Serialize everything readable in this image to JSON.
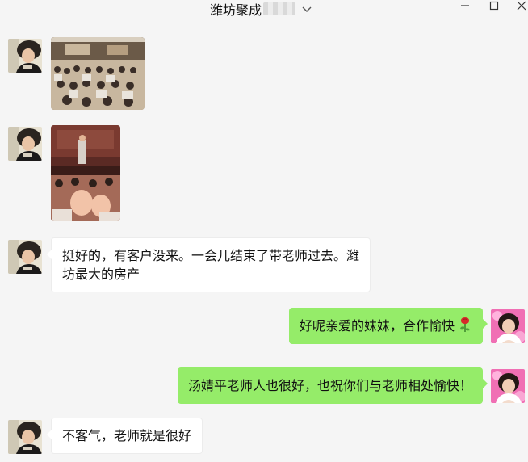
{
  "window": {
    "title": "潍坊聚成",
    "controls": [
      "minimize-icon",
      "maximize-icon",
      "close-icon"
    ]
  },
  "messages": [
    {
      "side": "in",
      "type": "image",
      "desc": "conference-hall-photo"
    },
    {
      "side": "in",
      "type": "image",
      "desc": "speaker-on-stage-photo"
    },
    {
      "side": "in",
      "type": "text",
      "lines": [
        "挺好的，有客户没来。一会儿结束了带老师过去。潍",
        "坊最大的房产"
      ]
    },
    {
      "side": "out",
      "type": "text",
      "text": "好呢亲爱的妹妹，合作愉快",
      "emoji": "rose-icon"
    },
    {
      "side": "out",
      "type": "text",
      "text": "汤婧平老师人也很好，也祝你们与老师相处愉快！"
    },
    {
      "side": "in",
      "type": "text",
      "text": "不客气，老师就是很好"
    }
  ],
  "colors": {
    "background": "#f5f5f5",
    "incoming_bubble": "#ffffff",
    "outgoing_bubble": "#95ec69"
  }
}
